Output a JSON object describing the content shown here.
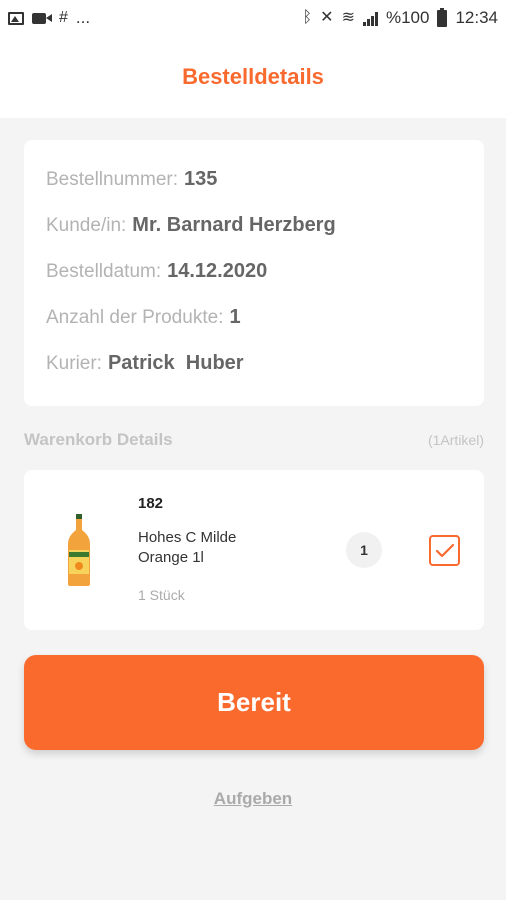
{
  "statusbar": {
    "left_more": "...",
    "battery_percent": "%100",
    "time": "12:34"
  },
  "header": {
    "title": "Bestelldetails"
  },
  "order": {
    "number_label": "Bestellnummer:",
    "number_value": "135",
    "customer_label": "Kunde/in:",
    "customer_value": "Mr. Barnard Herzberg",
    "date_label": "Bestelldatum:",
    "date_value": "14.12.2020",
    "count_label": "Anzahl der Produkte:",
    "count_value": "1",
    "courier_label": "Kurier:",
    "courier_value": "Patrick  Huber"
  },
  "cart": {
    "title": "Warenkorb Details",
    "count_text": "(1Artikel)",
    "items": [
      {
        "id": "182",
        "name": "Hohes C Milde Orange 1l",
        "unit": "1 Stück",
        "quantity": "1",
        "checked": true
      }
    ]
  },
  "actions": {
    "ready_label": "Bereit",
    "give_up_label": "Aufgeben"
  },
  "colors": {
    "accent": "#f96a2e"
  }
}
